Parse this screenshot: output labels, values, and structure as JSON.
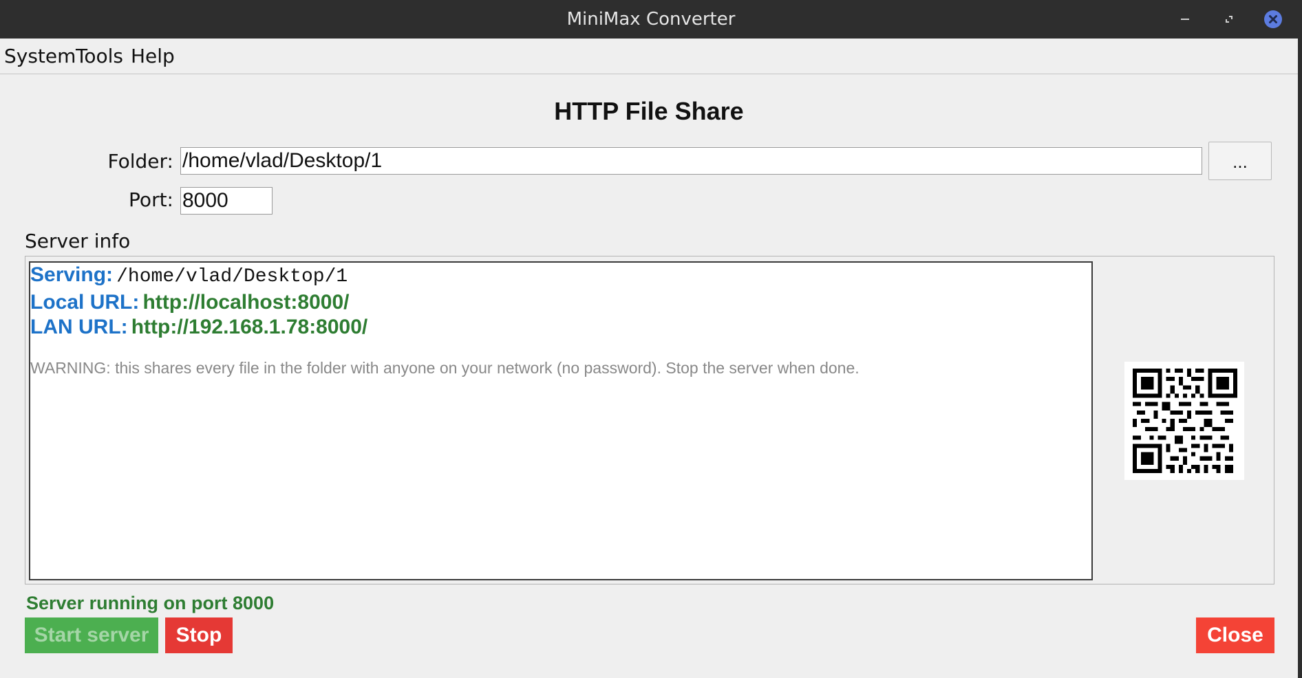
{
  "window": {
    "title": "MiniMax Converter"
  },
  "menu": {
    "items": [
      "System",
      "Tools",
      "Help"
    ]
  },
  "page": {
    "heading": "HTTP File Share"
  },
  "form": {
    "folder_label": "Folder:",
    "folder_value": "/home/vlad/Desktop/1",
    "browse_label": "...",
    "port_label": "Port:",
    "port_value": "8000"
  },
  "server_info": {
    "label": "Server info",
    "serving_key": "Serving:",
    "serving_value": "/home/vlad/Desktop/1",
    "local_key": "Local URL:",
    "local_value": "http://localhost:8000/",
    "lan_key": "LAN URL:",
    "lan_value": "http://192.168.1.78:8000/",
    "warning": "WARNING: this shares every file in the folder with anyone on your network (no password). Stop the server when done."
  },
  "status": {
    "text": "Server running on port 8000"
  },
  "buttons": {
    "start": "Start server",
    "stop": "Stop",
    "close": "Close"
  },
  "colors": {
    "titlebar": "#2e2e2e",
    "key_blue": "#1d72c8",
    "url_green": "#2e7d32",
    "start_green": "#4caf50",
    "stop_red": "#e53935",
    "close_red": "#f44336",
    "window_close_accent": "#5c7ce0"
  },
  "icons": {
    "window_minimize": "minimize-icon",
    "window_maximize": "maximize-icon",
    "window_close": "close-icon",
    "qr": "qr-code-icon"
  }
}
